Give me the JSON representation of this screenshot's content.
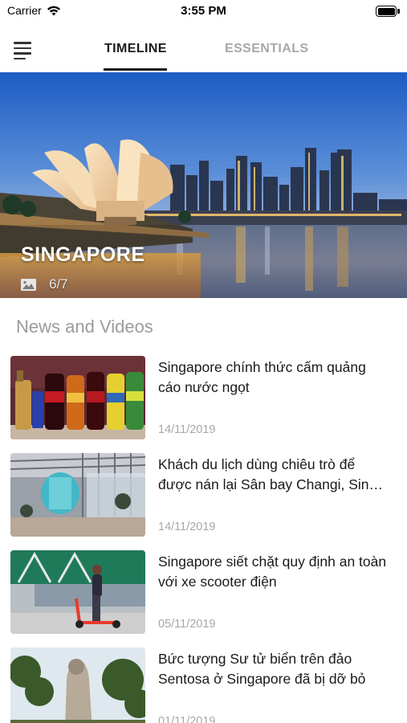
{
  "status_bar": {
    "carrier": "Carrier",
    "time": "3:55 PM"
  },
  "tabs": [
    {
      "label": "TIMELINE",
      "active": true
    },
    {
      "label": "ESSENTIALS",
      "active": false
    }
  ],
  "hero": {
    "title": "SINGAPORE",
    "counter": "6/7"
  },
  "section": {
    "title": "News and Videos"
  },
  "news": [
    {
      "title": "Singapore chính thức cấm quảng cáo nước ngọt",
      "date": "14/11/2019"
    },
    {
      "title": "Khách du lịch dùng chiêu trò để được nán lại Sân bay Changi, Sin…",
      "date": "14/11/2019"
    },
    {
      "title": "Singapore siết chặt quy định an toàn với xe scooter điện",
      "date": "05/11/2019"
    },
    {
      "title": "Bức tượng Sư tử biển trên đảo Sentosa ở Singapore đã bị dỡ bỏ",
      "date": "01/11/2019"
    }
  ],
  "colors": {
    "accent": "#1a1a1a",
    "inactive_tab": "#a8a8a8",
    "muted_text": "#9b9b9b"
  }
}
